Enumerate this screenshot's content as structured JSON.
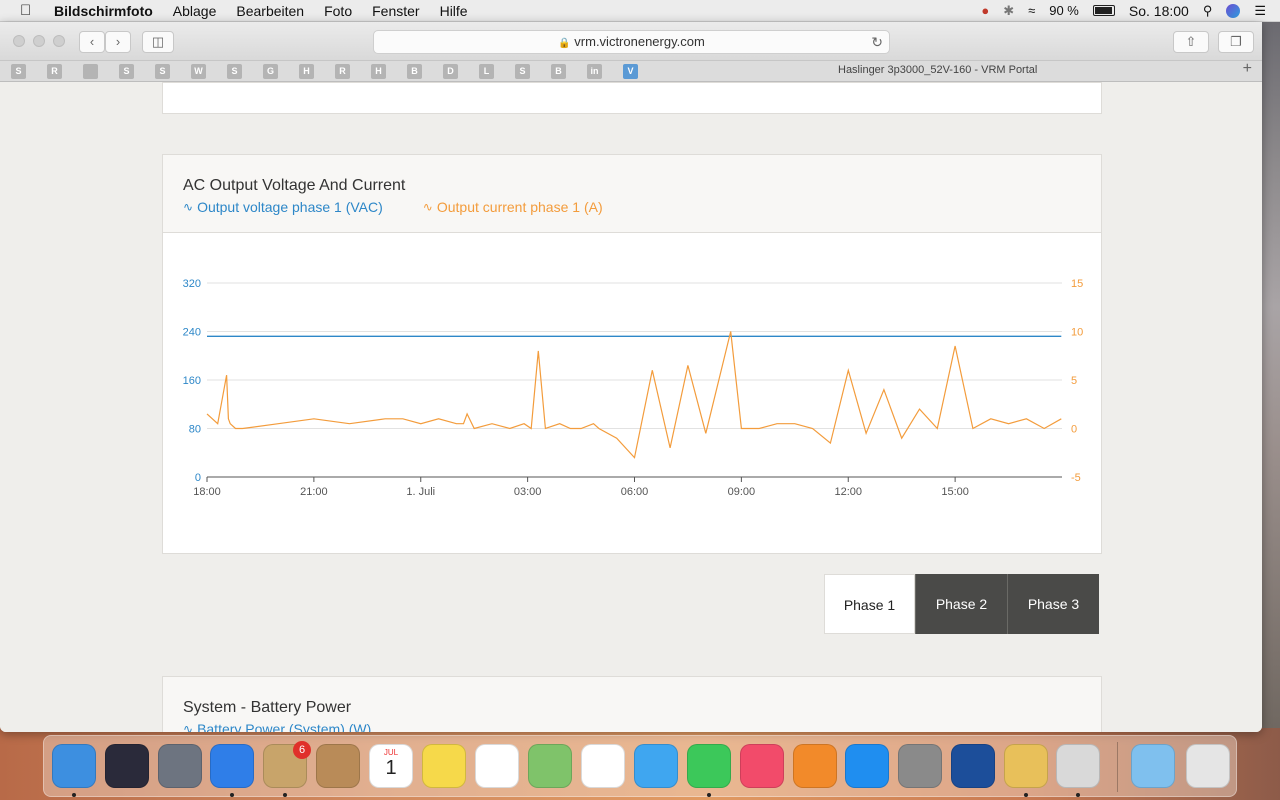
{
  "menubar": {
    "app_name": "Bildschirmfoto",
    "items": [
      "Ablage",
      "Bearbeiten",
      "Foto",
      "Fenster",
      "Hilfe"
    ],
    "battery_percent": "90 %",
    "clock": "So. 18:00"
  },
  "browser": {
    "url": "vrm.victronenergy.com",
    "tab_title": "Haslinger 3p3000_52V-160 - VRM Portal",
    "bookmarks": [
      "S",
      "R",
      "",
      "S",
      "S",
      "W",
      "S",
      "G",
      "H",
      "R",
      "H",
      "B",
      "D",
      "L",
      "S",
      "B",
      "in",
      "V"
    ]
  },
  "chart_card": {
    "title": "AC Output Voltage And Current",
    "legend": [
      {
        "label": "Output voltage phase 1 (VAC)",
        "color": "#2d87c8"
      },
      {
        "label": "Output current phase 1 (A)",
        "color": "#f39c3c"
      }
    ]
  },
  "chart_data": {
    "type": "line",
    "x_ticks": [
      "18:00",
      "21:00",
      "1. Juli",
      "03:00",
      "06:00",
      "09:00",
      "12:00",
      "15:00"
    ],
    "y_left_ticks": [
      "320",
      "240",
      "160",
      "80",
      "0"
    ],
    "y_right_ticks": [
      "15",
      "10",
      "5",
      "0",
      "-5"
    ],
    "ylim_left": [
      0,
      320
    ],
    "ylim_right": [
      -5,
      15
    ],
    "grid": true,
    "series": [
      {
        "name": "Output voltage phase 1 (VAC)",
        "axis": "left",
        "color": "#2d87c8",
        "x": [
          0,
          23.98
        ],
        "values": [
          232,
          232
        ]
      },
      {
        "name": "Output current phase 1 (A)",
        "axis": "right",
        "color": "#f39c3c",
        "x": [
          0.0,
          0.3,
          0.55,
          0.6,
          0.65,
          0.8,
          1.0,
          2.0,
          3.0,
          4.0,
          5.0,
          5.5,
          6.0,
          6.5,
          7.0,
          7.2,
          7.3,
          7.5,
          8.0,
          8.5,
          8.9,
          9.1,
          9.3,
          9.5,
          9.9,
          10.2,
          10.5,
          10.85,
          11.0,
          11.5,
          12.0,
          12.5,
          13.0,
          13.5,
          14.0,
          14.7,
          15.0,
          15.5,
          16.0,
          16.5,
          17.0,
          17.5,
          18.0,
          18.5,
          19.0,
          19.5,
          20.0,
          20.5,
          21.0,
          21.5,
          22.0,
          22.5,
          23.0,
          23.5,
          23.98
        ],
        "values": [
          1.5,
          0.5,
          5.5,
          1.0,
          0.5,
          0.0,
          0.0,
          0.5,
          1.0,
          0.5,
          1.0,
          1.0,
          0.5,
          1.0,
          0.5,
          0.5,
          1.5,
          0.0,
          0.5,
          0.0,
          0.5,
          0.0,
          8.0,
          0.0,
          0.5,
          0.0,
          0.0,
          0.5,
          0.0,
          -1.0,
          -3.0,
          6.0,
          -2.0,
          6.5,
          -0.5,
          10.0,
          0.0,
          0.0,
          0.5,
          0.5,
          0.0,
          -1.5,
          6.0,
          -0.5,
          4.0,
          -1.0,
          2.0,
          0.0,
          8.5,
          0.0,
          1.0,
          0.5,
          1.0,
          0.0,
          1.0
        ]
      }
    ]
  },
  "phase_tabs": [
    "Phase 1",
    "Phase 2",
    "Phase 3"
  ],
  "battery_card": {
    "title": "System - Battery Power",
    "legend": [
      {
        "label": "Battery Power (System) (W)",
        "color": "#2d87c8"
      }
    ]
  },
  "dock": {
    "apps": [
      "Finder",
      "Siri",
      "Launchpad",
      "Safari",
      "Mail",
      "Kontakte",
      "Kalender",
      "Notizen",
      "Erinnerungen",
      "Karten",
      "Fotos",
      "Nachrichten",
      "FaceTime",
      "iTunes",
      "iBooks",
      "App Store",
      "Systemeinstellungen",
      "VictronConnect",
      "Ballon",
      "Vorschau",
      "Downloads",
      "Papierkorb"
    ],
    "mail_badge": "6",
    "calendar_month": "JUL",
    "calendar_day": "1"
  }
}
